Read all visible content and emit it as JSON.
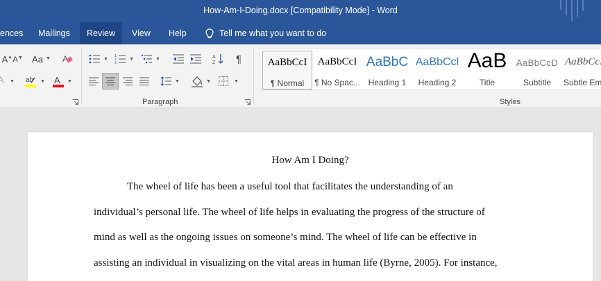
{
  "window": {
    "title": "How-Am-I-Doing.docx [Compatibility Mode]  -  Word"
  },
  "tabs": [
    {
      "label": "ences"
    },
    {
      "label": "Mailings"
    },
    {
      "label": "Review"
    },
    {
      "label": "View"
    },
    {
      "label": "Help"
    }
  ],
  "tell_me": {
    "label": "Tell me what you want to do"
  },
  "ribbon": {
    "paragraph_label": "Paragraph",
    "styles_label": "Styles",
    "font": {
      "change_case": "Aa",
      "grow": "A",
      "shrink": "A",
      "clear": "A"
    }
  },
  "styles": [
    {
      "sample": "AaBbCcI",
      "name": "¶ Normal"
    },
    {
      "sample": "AaBbCcI",
      "name": "¶ No Spac..."
    },
    {
      "sample": "AaBbC",
      "name": "Heading 1"
    },
    {
      "sample": "AaBbCcl",
      "name": "Heading 2"
    },
    {
      "sample": "AaB",
      "name": "Title"
    },
    {
      "sample": "AaBbCcD",
      "name": "Subtitle"
    },
    {
      "sample": "AaBbCcI",
      "name": "Subtle Em"
    }
  ],
  "document": {
    "title": "How Am I Doing?",
    "lines": [
      "The wheel of life has been a useful tool that facilitates the understanding of an",
      "individual’s personal life. The wheel of life helps in evaluating the progress of the structure of",
      "mind as well as the ongoing issues on someone’s mind. The wheel of life can be effective in",
      "assisting an individual in visualizing on the vital areas in human life (Byrne, 2005). For instance,"
    ]
  },
  "colors": {
    "accent": "#2b579a",
    "active_tab": "#1e4585",
    "ribbon_bg": "#f3f3f3",
    "page_bg": "#e6e6e6"
  }
}
